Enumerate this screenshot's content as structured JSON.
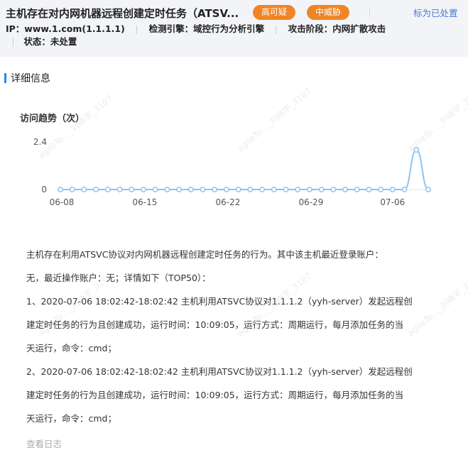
{
  "header": {
    "title": "主机存在对内网机器远程创建定时任务（ATSV...",
    "badge_high_credibility": "高可疑",
    "badge_medium_threat": "中威胁",
    "mark_action": "标为已处置",
    "ip": "IP：www.1.com(1.1.1.1)",
    "engine": "检测引擎：域控行为分析引擎",
    "attack_stage": "攻击阶段：内网扩散攻击",
    "status": "状态：未处置"
  },
  "section": {
    "title": "详细信息"
  },
  "chart_data": {
    "type": "line",
    "title": "访问趋势（次）",
    "x_ticks": [
      "06-08",
      "06-15",
      "06-22",
      "06-29",
      "07-06"
    ],
    "y_ticks": [
      "0",
      "2.4"
    ],
    "ylim": [
      0,
      2.4
    ],
    "series": [
      {
        "values": [
          0,
          0,
          0,
          0,
          0,
          0,
          0,
          0,
          0,
          0,
          0,
          0,
          0,
          0,
          0,
          0,
          0,
          0,
          0,
          0,
          0,
          0,
          0,
          0,
          0,
          0,
          0,
          0,
          0,
          0,
          2,
          0
        ]
      }
    ],
    "colors": {
      "line": "#8ec3f0",
      "point": "#8ec3f0"
    }
  },
  "detail": {
    "lines": [
      "主机存在利用ATSVC协议对内网机器远程创建定时任务的行为。其中该主机最近登录账户：",
      "无，最近操作账户：无；详情如下（TOP50）：",
      "1、2020-07-06 18:02:42-18:02:42 主机利用ATSVC协议对1.1.1.2（yyh-server）发起远程创",
      "建定时任务的行为且创建成功，运行时间：10:09:05，运行方式：周期运行，每月添加任务的当",
      "天运行，命令：cmd；",
      "2、2020-07-06 18:02:42-18:02:42 主机利用ATSVC协议对1.1.1.2（yyh-server）发起远程创",
      "建定时任务的行为且创建成功，运行时间：10:09:05，运行方式：周期运行，每月添加任务的当",
      "天运行，命令：cmd；"
    ],
    "view_log": "查看日志"
  },
  "watermark": "agileTe..._刘晓宇_3107"
}
